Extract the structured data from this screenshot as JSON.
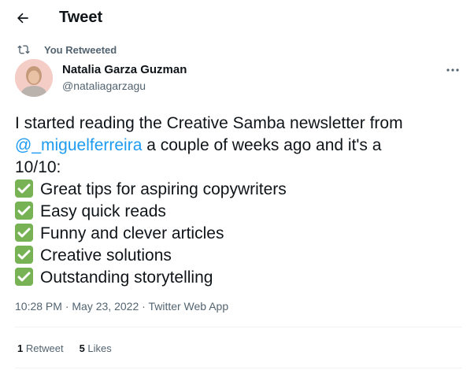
{
  "header": {
    "title": "Tweet",
    "back_icon": "arrow-left-icon"
  },
  "retweet": {
    "text": "You Retweeted",
    "icon": "retweet-icon"
  },
  "author": {
    "name": "Natalia Garza Guzman",
    "handle": "@nataliagarzagu",
    "avatar_icon": "avatar-photo"
  },
  "tweet": {
    "line1": "I started reading the Creative Samba newsletter from",
    "mention": "@_miguelferreira",
    "line2_rest": " a couple of weeks ago and it's a",
    "line3": "10/10:",
    "items": [
      "Great tips for aspiring copywriters",
      "Easy quick reads",
      "Funny and clever articles",
      "Creative solutions",
      "Outstanding storytelling"
    ]
  },
  "meta": {
    "time": "10:28 PM",
    "sep": " · ",
    "date": "May 23, 2022",
    "source": "Twitter Web App"
  },
  "stats": {
    "retweets_count": "1",
    "retweets_label": "Retweet",
    "likes_count": "5",
    "likes_label": "Likes"
  },
  "colors": {
    "accent": "#1d9bf0",
    "text_primary": "#0f1419",
    "text_secondary": "#536471",
    "check": "#77b255",
    "divider": "#eff3f4"
  }
}
